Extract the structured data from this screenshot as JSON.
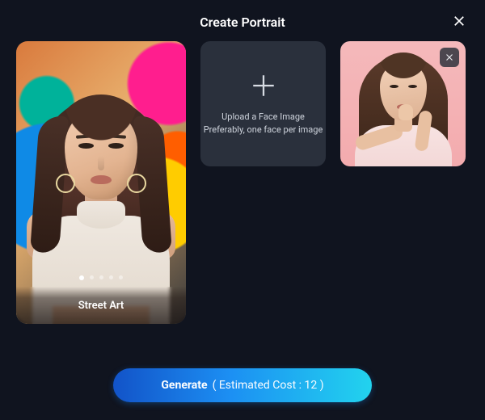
{
  "title": "Create Portrait",
  "close_label": "Close",
  "style_card": {
    "caption": "Street Art",
    "dot_count": 5,
    "active_dot_index": 0
  },
  "upload": {
    "line1": "Upload a Face Image",
    "line2": "Preferably, one face per image"
  },
  "preview": {
    "remove_label": "Remove uploaded image"
  },
  "generate": {
    "label": "Generate",
    "cost_text": "( Estimated Cost : 12 )",
    "estimated_cost": 12
  },
  "colors": {
    "background": "#10141f",
    "panel": "#2a303c",
    "gradient_start": "#1253c8",
    "gradient_end": "#22d3ee"
  }
}
